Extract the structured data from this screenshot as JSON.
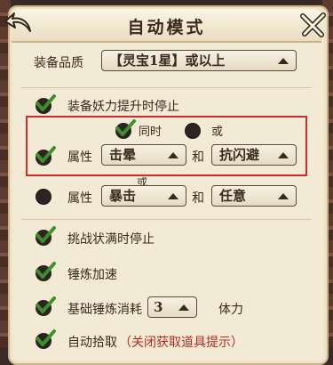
{
  "header": {
    "title": "自动模式"
  },
  "quality": {
    "label": "装备品质",
    "value": "【灵宝1星】或以上"
  },
  "stop_on_power": {
    "label": "装备妖力提升时停止"
  },
  "logic": {
    "and_label": "同时",
    "or_label": "或"
  },
  "attr_row1": {
    "label": "属性",
    "value1": "击晕",
    "joiner": "和",
    "value2": "抗闪避"
  },
  "connector_or": "或",
  "attr_row2": {
    "label": "属性",
    "value1": "暴击",
    "joiner": "和",
    "value2": "任意"
  },
  "stop_on_full": {
    "label": "挑战状满时停止"
  },
  "refine_speed": {
    "label": "锤炼加速"
  },
  "refine_cost": {
    "label": "基础锤炼消耗",
    "value": "3",
    "unit": "体力"
  },
  "auto_pickup": {
    "label": "自动拾取",
    "note": "（关闭获取道具提示）"
  },
  "colors": {
    "accent_red": "#c9302c",
    "panel": "#f3ead6",
    "check_green": "#3e8f2a"
  }
}
